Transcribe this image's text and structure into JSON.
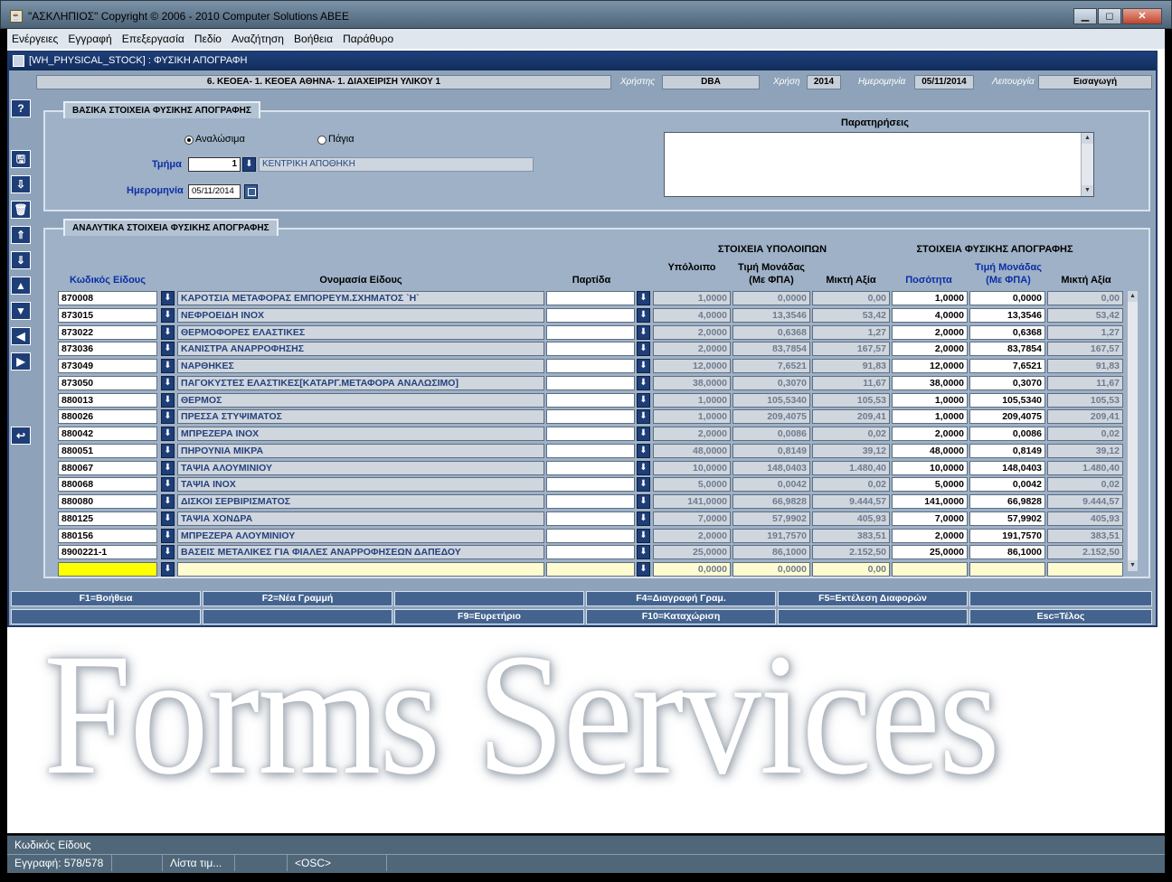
{
  "window": {
    "title": "\"ΑΣΚΛΗΠΙΟΣ\" Copyright © 2006 - 2010 Computer Solutions ABEE",
    "minimize": "▁",
    "maximize": "◻",
    "close": "✕"
  },
  "menu": [
    "Ενέργειες",
    "Εγγραφή",
    "Επεξεργασία",
    "Πεδίο",
    "Αναζήτηση",
    "Βοήθεια",
    "Παράθυρο"
  ],
  "form": {
    "title": "[WH_PHYSICAL_STOCK]  :  ΦΥΣΙΚΗ ΑΠΟΓΡΑΦΗ",
    "org": "6. ΚΕΟΕΑ- 1. ΚΕΟΕΑ ΑΘΗΝΑ- 1. ΔΙΑΧΕΙΡΙΣΗ ΥΛΙΚΟΥ 1",
    "user_label": "Χρήστης",
    "user": "DBA",
    "year_label": "Χρήση",
    "year": "2014",
    "date_label": "Ημερομηνία",
    "date": "05/11/2014",
    "mode_label": "Λειτουργία",
    "mode": "Εισαγωγή"
  },
  "toolbar": {
    "help": "?",
    "save": "🖫",
    "down": "⇩",
    "delete": "🗑",
    "first": "⇑",
    "last": "⇓",
    "prev": "▲",
    "next": "▼",
    "left": "◀",
    "right": "▶",
    "back": "↩"
  },
  "basic": {
    "tab": "ΒΑΣΙΚΑ ΣΤΟΙΧΕΙΑ ΦΥΣΙΚΗΣ ΑΠΟΓΡΑΦΗΣ",
    "radio_consumables": "Αναλώσιμα",
    "radio_fixed": "Πάγια",
    "dept_label": "Τμήμα",
    "dept_code": "1",
    "dept_name": "ΚΕΝΤΡΙΚΗ ΑΠΟΘΗΚΗ",
    "date_label": "Ημερομηνία",
    "date": "05/11/2014",
    "notes_label": "Παρατηρήσεις"
  },
  "detail": {
    "tab": "ΑΝΑΛΥΤΙΚΑ ΣΤΟΙΧΕΙΑ ΦΥΣΙΚΗΣ ΑΠΟΓΡΑΦΗΣ",
    "group_balance": "ΣΤΟΙΧΕΙΑ ΥΠΟΛΟΙΠΩΝ",
    "group_physical": "ΣΤΟΙΧΕΙΑ ΦΥΣΙΚΗΣ ΑΠΟΓΡΑΦΗΣ",
    "col_code": "Κωδικός Είδους",
    "col_name": "Ονομασία Είδους",
    "col_batch": "Παρτίδα",
    "col_balance": "Υπόλοιπο",
    "col_unit_price_1": "Τιμή Μονάδας",
    "col_unit_price_2": "(Με ΦΠΑ)",
    "col_gross": "Μικτή Αξία",
    "col_qty": "Ποσότητα",
    "col_unit_price_b1": "Τιμή Μονάδας",
    "col_unit_price_b2": "(Με ΦΠΑ)",
    "col_gross_b": "Μικτή Αξία",
    "lov": "⬇",
    "rows": [
      {
        "code": "870008",
        "name": "ΚΑΡΟΤΣΙΑ ΜΕΤΑΦΟΡΑΣ ΕΜΠΟΡΕΥΜ.ΣΧΗΜΑΤΟΣ `Η`",
        "balance": "1,0000",
        "price": "0,0000",
        "value": "0,00",
        "qty": "1,0000",
        "qprice": "0,0000",
        "qvalue": "0,00"
      },
      {
        "code": "873015",
        "name": "ΝΕΦΡΟΕΙΔΗ ΙΝΟΧ",
        "balance": "4,0000",
        "price": "13,3546",
        "value": "53,42",
        "qty": "4,0000",
        "qprice": "13,3546",
        "qvalue": "53,42"
      },
      {
        "code": "873022",
        "name": "ΘΕΡΜΟΦΟΡΕΣ ΕΛΑΣΤΙΚΕΣ",
        "balance": "2,0000",
        "price": "0,6368",
        "value": "1,27",
        "qty": "2,0000",
        "qprice": "0,6368",
        "qvalue": "1,27"
      },
      {
        "code": "873036",
        "name": "ΚΑΝΙΣΤΡΑ ΑΝΑΡΡΟΦΗΣΗΣ",
        "balance": "2,0000",
        "price": "83,7854",
        "value": "167,57",
        "qty": "2,0000",
        "qprice": "83,7854",
        "qvalue": "167,57"
      },
      {
        "code": "873049",
        "name": "ΝΑΡΘΗΚΕΣ",
        "balance": "12,0000",
        "price": "7,6521",
        "value": "91,83",
        "qty": "12,0000",
        "qprice": "7,6521",
        "qvalue": "91,83"
      },
      {
        "code": "873050",
        "name": "ΠΑΓΟΚΥΣΤΕΣ ΕΛΑΣΤΙΚΕΣ[ΚΑΤΑΡΓ.ΜΕΤΑΦΟΡΑ ΑΝΑΛΩΣΙΜΟ]",
        "balance": "38,0000",
        "price": "0,3070",
        "value": "11,67",
        "qty": "38,0000",
        "qprice": "0,3070",
        "qvalue": "11,67"
      },
      {
        "code": "880013",
        "name": "ΘΕΡΜΟΣ",
        "balance": "1,0000",
        "price": "105,5340",
        "value": "105,53",
        "qty": "1,0000",
        "qprice": "105,5340",
        "qvalue": "105,53"
      },
      {
        "code": "880026",
        "name": "ΠΡΕΣΣΑ ΣΤΥΨΙΜΑΤΟΣ",
        "balance": "1,0000",
        "price": "209,4075",
        "value": "209,41",
        "qty": "1,0000",
        "qprice": "209,4075",
        "qvalue": "209,41"
      },
      {
        "code": "880042",
        "name": "ΜΠΡΕΖΕΡΑ ΙΝΟΧ",
        "balance": "2,0000",
        "price": "0,0086",
        "value": "0,02",
        "qty": "2,0000",
        "qprice": "0,0086",
        "qvalue": "0,02"
      },
      {
        "code": "880051",
        "name": "ΠΗΡΟΥΝΙΑ ΜΙΚΡΑ",
        "balance": "48,0000",
        "price": "0,8149",
        "value": "39,12",
        "qty": "48,0000",
        "qprice": "0,8149",
        "qvalue": "39,12"
      },
      {
        "code": "880067",
        "name": "ΤΑΨΙΑ ΑΛΟΥΜΙΝΙΟΥ",
        "balance": "10,0000",
        "price": "148,0403",
        "value": "1.480,40",
        "qty": "10,0000",
        "qprice": "148,0403",
        "qvalue": "1.480,40"
      },
      {
        "code": "880068",
        "name": "ΤΑΨΙΑ ΙΝΟΧ",
        "balance": "5,0000",
        "price": "0,0042",
        "value": "0,02",
        "qty": "5,0000",
        "qprice": "0,0042",
        "qvalue": "0,02"
      },
      {
        "code": "880080",
        "name": "ΔΙΣΚΟΙ ΣΕΡΒΙΡΙΣΜΑΤΟΣ",
        "balance": "141,0000",
        "price": "66,9828",
        "value": "9.444,57",
        "qty": "141,0000",
        "qprice": "66,9828",
        "qvalue": "9.444,57"
      },
      {
        "code": "880125",
        "name": "ΤΑΨΙΑ ΧΟΝΔΡΑ",
        "balance": "7,0000",
        "price": "57,9902",
        "value": "405,93",
        "qty": "7,0000",
        "qprice": "57,9902",
        "qvalue": "405,93"
      },
      {
        "code": "880156",
        "name": "ΜΠΡΕΖΕΡΑ ΑΛΟΥΜΙΝΙΟΥ",
        "balance": "2,0000",
        "price": "191,7570",
        "value": "383,51",
        "qty": "2,0000",
        "qprice": "191,7570",
        "qvalue": "383,51"
      },
      {
        "code": "8900221-1",
        "name": "ΒΑΣΕΙΣ ΜΕΤΑΛΙΚΕΣ ΓΙΑ ΦΙΑΛΕΣ ΑΝΑΡΡΟΦΗΣΕΩΝ ΔΑΠΕΔΟΥ",
        "balance": "25,0000",
        "price": "86,1000",
        "value": "2.152,50",
        "qty": "25,0000",
        "qprice": "86,1000",
        "qvalue": "2.152,50"
      },
      {
        "code": "",
        "name": "",
        "balance": "0,0000",
        "price": "0,0000",
        "value": "0,00",
        "qty": "",
        "qprice": "",
        "qvalue": ""
      }
    ]
  },
  "fkeys": {
    "f1": "F1=Βοήθεια",
    "f2": "F2=Νέα Γραμμή",
    "f4": "F4=Διαγραφή Γραμ.",
    "f5": "F5=Εκτέλεση Διαφορών",
    "f9": "F9=Ευρετήριο",
    "f10": "F10=Καταχώριση",
    "esc": "Esc=Τέλος"
  },
  "watermark": "Forms Services",
  "status": {
    "field": "Κωδικός Είδους",
    "record": "Εγγραφή: 578/578",
    "seg2": "",
    "list": "Λίστα τιμ...",
    "seg4": "",
    "osc": "<OSC>"
  }
}
